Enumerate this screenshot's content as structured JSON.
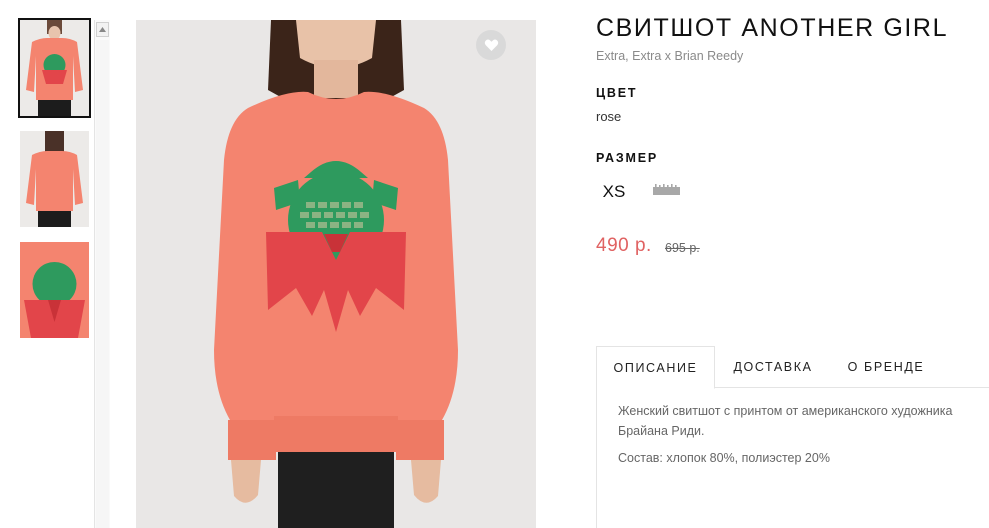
{
  "product": {
    "title": "СВИТШОТ ANOTHER GIRL",
    "brand": "Extra, Extra x Brian Reedy",
    "color_label": "ЦВЕТ",
    "color_value": "rose",
    "size_label": "РАЗМЕР",
    "sizes": [
      "XS"
    ],
    "price": "490 р.",
    "old_price": "695 р."
  },
  "tabs": [
    {
      "label": "ОПИСАНИЕ",
      "active": true
    },
    {
      "label": "ДОСТАВКА",
      "active": false
    },
    {
      "label": "О БРЕНДЕ",
      "active": false
    }
  ],
  "description": {
    "text": "Женский свитшот с принтом от американского художника Брайана Риди.",
    "composition": "Состав: хлопок 80%, полиэстер 20%"
  },
  "icons": {
    "favorite": "heart-icon",
    "size_chart": "ruler-icon",
    "scroll_up": "chevron-up-icon"
  },
  "colors": {
    "price": "#e06262",
    "sweatshirt": "#f4846f",
    "print_green": "#2e9a5e",
    "print_red": "#e2454a"
  }
}
